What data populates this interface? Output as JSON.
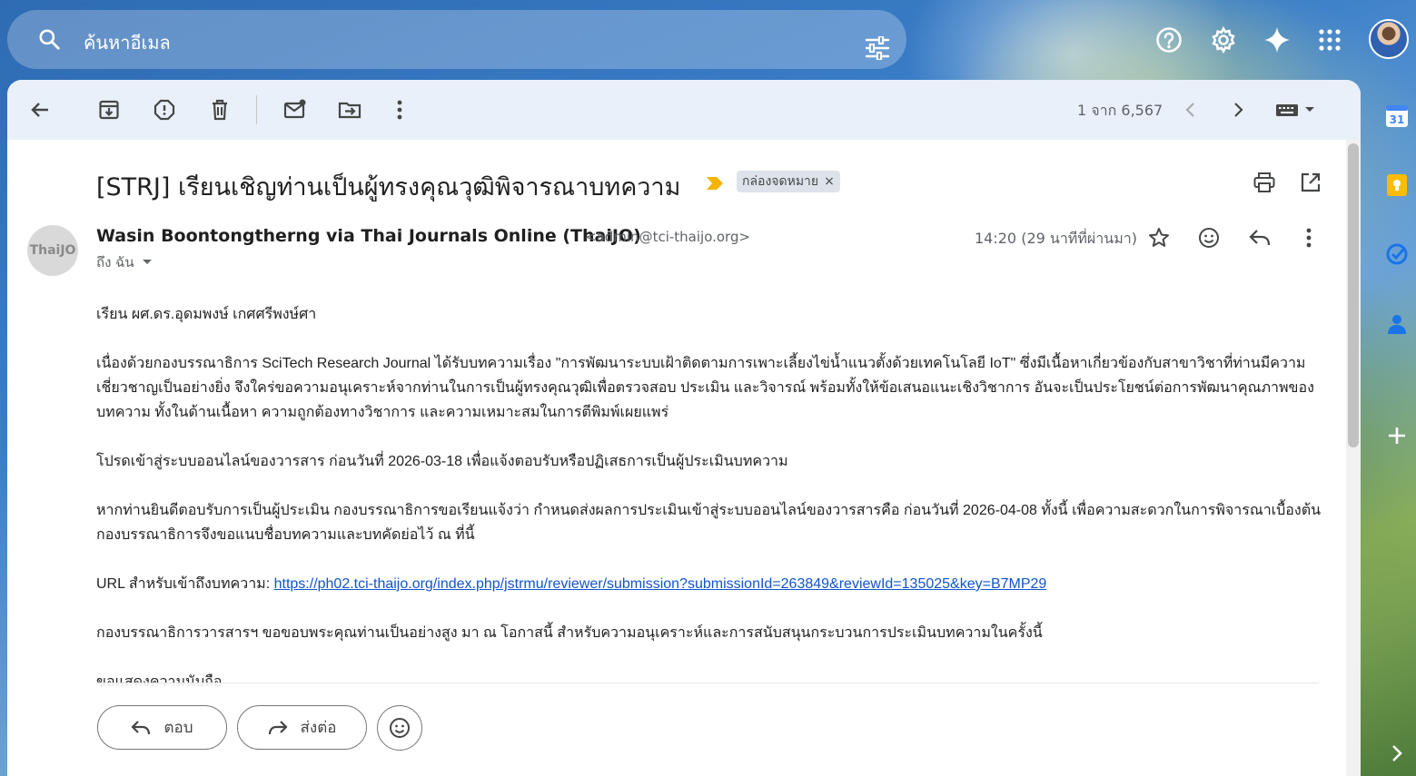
{
  "search": {
    "placeholder": "ค้นหาอีเมล"
  },
  "toolbar": {
    "pager": "1 จาก 6,567"
  },
  "email": {
    "subject": "[STRJ] เรียนเชิญท่านเป็นผู้ทรงคุณวุฒิพิจารณาบทความ",
    "label": "กล่องจดหมาย",
    "sender_name": "Wasin Boontongtherng via Thai Journals Online (ThaiJO)",
    "sender_email": "<admin@tci-thaijo.org>",
    "sender_avatar_text": "ThaiJO",
    "to": "ถึง ฉัน",
    "time": "14:20 (29 นาทีที่ผ่านมา)",
    "greeting": "เรียน ผศ.ดร.อุดมพงษ์ เกศศรีพงษ์ศา",
    "paragraph1": "เนื่องด้วยกองบรรณาธิการ SciTech Research Journal ได้รับบทความเรื่อง \"การพัฒนาระบบเฝ้าติดตามการเพาะเลี้ยงไข่น้ำแนวตั้งด้วยเทคโนโลยี IoT\" ซึ่งมีเนื้อหาเกี่ยวข้องกับสาขาวิชาที่ท่านมีความเชี่ยวชาญเป็นอย่างยิ่ง จึงใคร่ขอความอนุเคราะห์จากท่านในการเป็นผู้ทรงคุณวุฒิเพื่อตรวจสอบ ประเมิน และวิจารณ์ พร้อมทั้งให้ข้อเสนอแนะเชิงวิชาการ อันจะเป็นประโยชน์ต่อการพัฒนาคุณภาพของบทความ ทั้งในด้านเนื้อหา ความถูกต้องทางวิชาการ และความเหมาะสมในการตีพิมพ์เผยแพร่",
    "paragraph2": "โปรดเข้าสู่ระบบออนไลน์ของวารสาร ก่อนวันที่ 2026-03-18 เพื่อแจ้งตอบรับหรือปฏิเสธการเป็นผู้ประเมินบทความ",
    "paragraph3": "หากท่านยินดีตอบรับการเป็นผู้ประเมิน กองบรรณาธิการขอเรียนแจ้งว่า กำหนดส่งผลการประเมินเข้าสู่ระบบออนไลน์ของวารสารคือ ก่อนวันที่ 2026-04-08 ทั้งนี้ เพื่อความสะดวกในการพิจารณาเบื้องต้น กองบรรณาธิการจึงขอแนบชื่อบทความและบทคัดย่อไว้ ณ ที่นี้",
    "url_label": "URL สำหรับเข้าถึงบทความ: ",
    "url": "https://ph02.tci-thaijo.org/index.php/jstrmu/reviewer/submission?submissionId=263849&reviewId=135025&key=B7MP29",
    "paragraph4": "กองบรรณาธิการวารสารฯ ขอขอบพระคุณท่านเป็นอย่างสูง มา ณ โอกาสนี้ สำหรับความอนุเคราะห์และการสนับสนุนกระบวนการประเมินบทความในครั้งนี้",
    "closing": "ขอแสดงความนับถือ"
  },
  "actions": {
    "reply_label": "ตอบ",
    "forward_label": "ส่งต่อ"
  },
  "side_rail": {
    "calendar_day": "31"
  },
  "colors": {
    "link": "#1155cc",
    "importance": "#f4b400",
    "toolbar_bg": "#e8eff9"
  },
  "icons": [
    "search-icon",
    "tune-icon",
    "help-icon",
    "settings-icon",
    "gemini-icon",
    "apps-icon",
    "back-icon",
    "archive-icon",
    "spam-icon",
    "delete-icon",
    "mark-unread-icon",
    "move-icon",
    "more-icon",
    "chevron-left-icon",
    "chevron-right-icon",
    "keyboard-icon",
    "print-icon",
    "open-new-window-icon",
    "star-icon",
    "emoji-icon",
    "reply-icon",
    "forward-icon",
    "calendar-icon",
    "keep-icon",
    "tasks-icon",
    "contacts-icon",
    "add-icon"
  ]
}
